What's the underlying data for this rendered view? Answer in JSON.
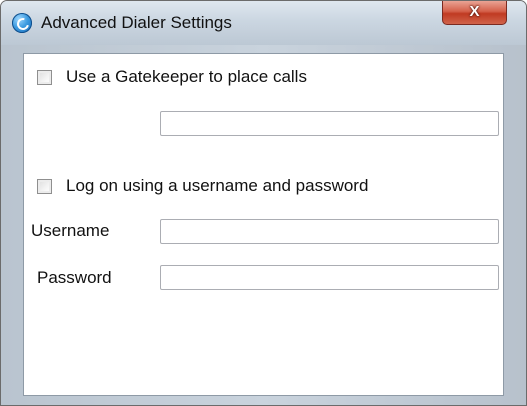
{
  "window": {
    "title": "Advanced Dialer Settings",
    "close_label": "X",
    "app_icon": "dialer-app-icon"
  },
  "gatekeeper": {
    "checkbox_label": "Use a Gatekeeper to place calls",
    "checked": false,
    "address_value": ""
  },
  "logon": {
    "checkbox_label": "Log on using a username and password",
    "checked": false,
    "username_label": "Username",
    "username_value": "",
    "password_label": "Password",
    "password_value": ""
  },
  "colors": {
    "close_button": "#c84a33",
    "frame": "#c1cbd6",
    "client_bg": "#ffffff"
  }
}
